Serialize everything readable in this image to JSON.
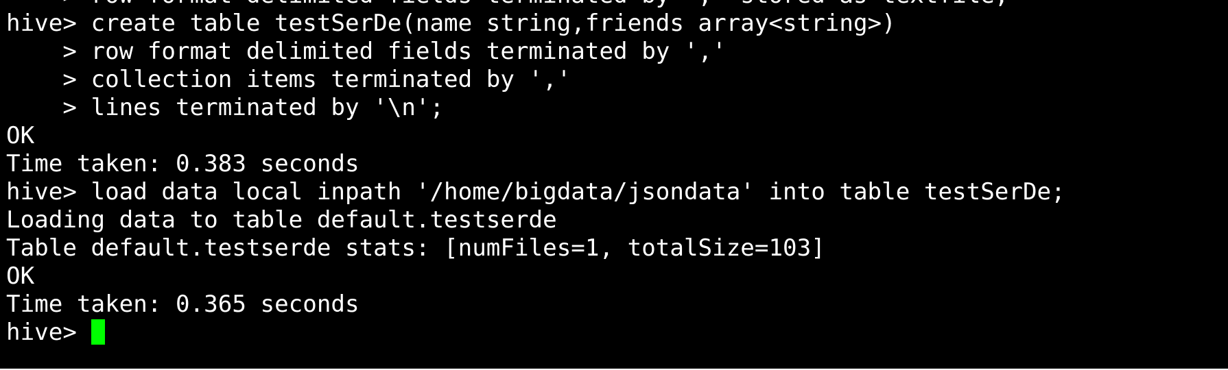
{
  "terminal": {
    "lines": [
      "    > row format delimited fields terminated by ',' stored as textfile;",
      "hive> create table testSerDe(name string,friends array<string>)",
      "    > row format delimited fields terminated by ','",
      "    > collection items terminated by ','",
      "    > lines terminated by '\\n';",
      "OK",
      "Time taken: 0.383 seconds",
      "hive> load data local inpath '/home/bigdata/jsondata' into table testSerDe;",
      "Loading data to table default.testserde",
      "Table default.testserde stats: [numFiles=1, totalSize=103]",
      "OK",
      "Time taken: 0.365 seconds"
    ],
    "prompt": "hive> ",
    "cursor_color": "#00ff00",
    "background_color": "#000000",
    "text_color": "#ffffff"
  }
}
